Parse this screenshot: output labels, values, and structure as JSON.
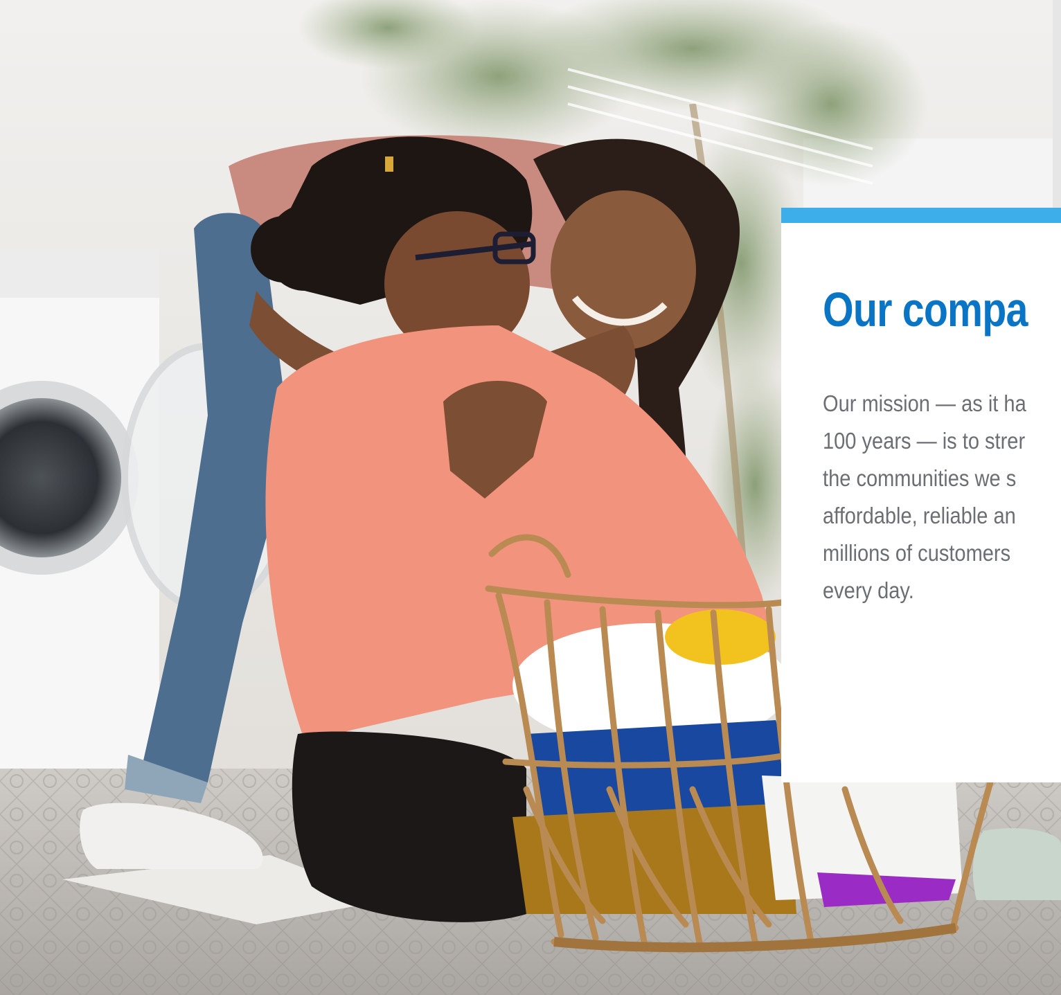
{
  "hero": {
    "image_alt": "Two smiling girls hugging while sorting laundry next to a washing machine",
    "card": {
      "accent_color": "#3daee9",
      "title_color": "#0a74c5",
      "title": "Our compa",
      "body_lines": [
        "Our mission — as it ha",
        "100 years — is to strer",
        "the communities we s",
        "affordable, reliable an",
        "millions of customers",
        "every day."
      ]
    }
  }
}
